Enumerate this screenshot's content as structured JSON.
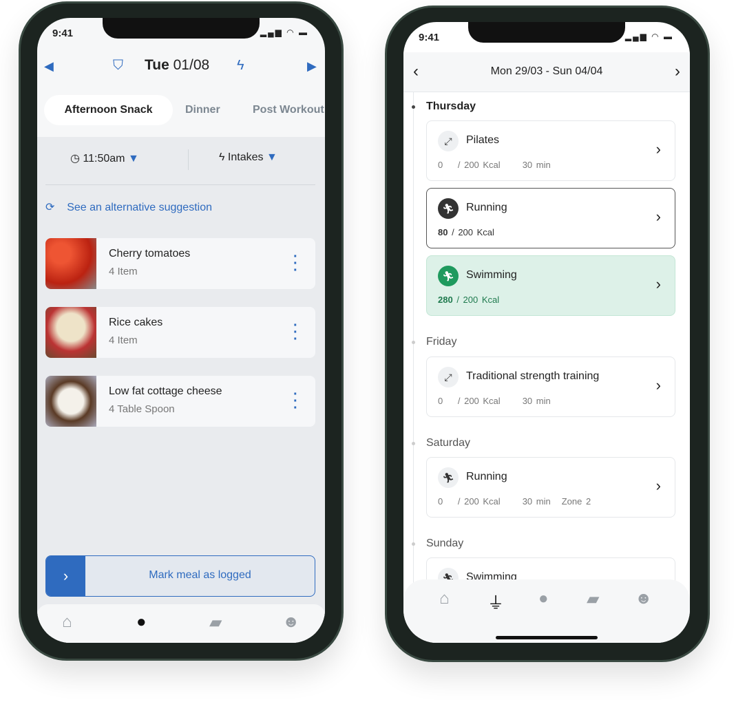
{
  "left": {
    "status_time": "9:41",
    "header": {
      "day": "Tue",
      "date": "01/08"
    },
    "tabs": [
      {
        "label": "Afternoon Snack",
        "active": true
      },
      {
        "label": "Dinner"
      },
      {
        "label": "Post Workout"
      }
    ],
    "time": "11:50am",
    "intakes": "Intakes",
    "suggestion": "See an alternative suggestion",
    "foods": [
      {
        "name": "Cherry tomatoes",
        "qty": "4 Item"
      },
      {
        "name": "Rice cakes",
        "qty": "4 Item"
      },
      {
        "name": "Low fat cottage cheese",
        "qty": "4 Table Spoon"
      }
    ],
    "mark_logged": "Mark meal as logged",
    "nav": [
      "home-icon",
      "apple-icon",
      "chat-icon",
      "profile-icon"
    ],
    "accent": "#2f6bbf"
  },
  "right": {
    "status_time": "9:41",
    "range": "Mon 29/03 - Sun 04/04",
    "days": [
      {
        "label": "Thursday",
        "items": [
          {
            "name": "Pilates",
            "done": "0",
            "goal": "/ 200 Kcal",
            "duration": "30 min"
          },
          {
            "name": "Running",
            "done": "80",
            "goal": "/ 200 Kcal"
          },
          {
            "name": "Swimming",
            "done": "280",
            "goal": "/ 200 Kcal"
          }
        ]
      },
      {
        "label": "Friday",
        "items": [
          {
            "name": "Traditional strength training",
            "done": "0",
            "goal": "/ 200 Kcal",
            "duration": "30 min"
          }
        ]
      },
      {
        "label": "Saturday",
        "items": [
          {
            "name": "Running",
            "done": "0",
            "goal": "/ 200 Kcal",
            "duration": "30 min",
            "zone": "Zone 2"
          }
        ]
      },
      {
        "label": "Sunday",
        "items": [
          {
            "name": "Swimming"
          }
        ]
      }
    ],
    "nav": [
      "home-icon",
      "workout-icon",
      "apple-icon",
      "chat-icon",
      "profile-icon"
    ],
    "success_color": "#1f9a5e"
  }
}
